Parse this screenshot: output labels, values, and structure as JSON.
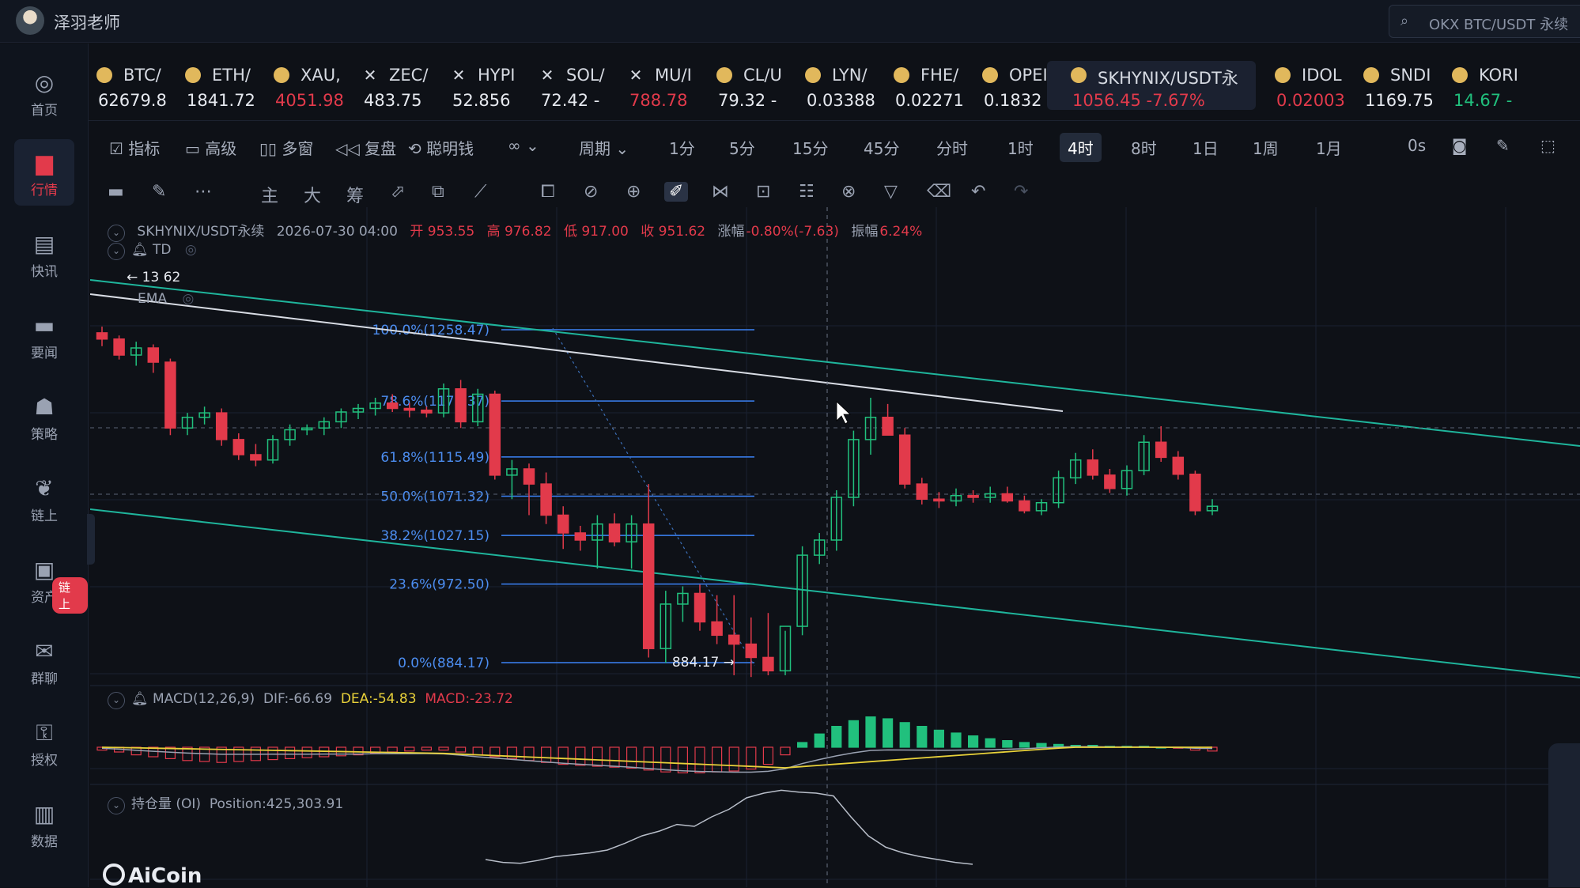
{
  "user": {
    "name": "泽羽老师"
  },
  "search": {
    "placeholder": "OKX BTC/USDT 永续"
  },
  "sidebar": {
    "items": [
      {
        "label": "首页",
        "icon": "home-icon"
      },
      {
        "label": "行情",
        "icon": "chart-bars-icon",
        "active": true
      },
      {
        "label": "快讯",
        "icon": "news-icon"
      },
      {
        "label": "要闻",
        "icon": "document-icon"
      },
      {
        "label": "策略",
        "icon": "robot-icon"
      },
      {
        "label": "链上",
        "icon": "chain-icon"
      },
      {
        "label": "资产",
        "icon": "wallet-icon"
      },
      {
        "label": "群聊",
        "icon": "chat-icon"
      },
      {
        "label": "授权",
        "icon": "key-icon"
      },
      {
        "label": "数据",
        "icon": "data-icon"
      }
    ],
    "badge": "链上"
  },
  "tickers": [
    {
      "symbol": "BTC/",
      "price": "62679.8",
      "dir": "up",
      "icon": "coin"
    },
    {
      "symbol": "ETH/",
      "price": "1841.72",
      "dir": "up",
      "icon": "coin"
    },
    {
      "symbol": "XAU,",
      "price": "4051.98",
      "dir": "down",
      "icon": "coin"
    },
    {
      "symbol": "ZEC/",
      "price": "483.75",
      "dir": "up",
      "icon": "x"
    },
    {
      "symbol": "HYPI",
      "price": "52.856",
      "dir": "up",
      "icon": "x"
    },
    {
      "symbol": "SOL/",
      "price": "72.42 -",
      "dir": "up",
      "icon": "x"
    },
    {
      "symbol": "MU/I",
      "price": "788.78",
      "dir": "down",
      "icon": "x"
    },
    {
      "symbol": "CL/U",
      "price": "79.32 -",
      "dir": "up",
      "icon": "coin"
    },
    {
      "symbol": "LYN/",
      "price": "0.03388",
      "dir": "up",
      "icon": "coin"
    },
    {
      "symbol": "FHE/",
      "price": "0.02271",
      "dir": "up",
      "icon": "coin"
    },
    {
      "symbol": "OPEI",
      "price": "0.1832",
      "dir": "up",
      "icon": "coin"
    },
    {
      "symbol": "SKHYNIX/USDT永",
      "price": "1056.45 -7.67%",
      "dir": "down",
      "icon": "coin",
      "active": true
    },
    {
      "symbol": "IDOL",
      "price": "0.02003",
      "dir": "down",
      "icon": "coin"
    },
    {
      "symbol": "SNDI",
      "price": "1169.75",
      "dir": "up",
      "icon": "coin"
    },
    {
      "symbol": "KORI",
      "price": "14.67 -",
      "dir": "green",
      "icon": "coin"
    }
  ],
  "toolbar": {
    "indicators": "指标",
    "advanced": "高级",
    "multi_window": "多窗",
    "replay": "复盘",
    "smart_money": "聪明钱",
    "period_label": "周期",
    "periods": [
      "1分",
      "5分",
      "15分",
      "45分",
      "分时",
      "1时",
      "4时",
      "8时",
      "1日",
      "1周",
      "1月"
    ],
    "active_period": "4时",
    "countdown": "0s"
  },
  "drawbar": {
    "main": "主",
    "big": "大",
    "chip": "筹"
  },
  "info": {
    "pair": "SKHYNIX/USDT永续",
    "datetime": "2026-07-30 04:00",
    "open": "开 953.55",
    "high": "高 976.82",
    "low": "低 917.00",
    "close": "收 951.62",
    "change_label": "涨幅",
    "change": "-0.80%(-7.63)",
    "amplitude_label": "振幅",
    "amplitude": "6.24%"
  },
  "indicators": {
    "td": "TD",
    "ema": "EMA",
    "marker_value": "62",
    "marker_prefix": "13",
    "macd": {
      "name": "MACD(12,26,9)",
      "dif": "DIF:-66.69",
      "dea": "DEA:-54.83",
      "macd": "MACD:-23.72"
    },
    "oi": {
      "name": "持仓量 (OI)",
      "position": "Position:425,303.91"
    }
  },
  "fib_levels": [
    {
      "label": "100.0%(1258.47)",
      "price": 1258.47
    },
    {
      "label": "78.6%(1178.37)",
      "price": 1178.37
    },
    {
      "label": "61.8%(1115.49)",
      "price": 1115.49
    },
    {
      "label": "50.0%(1071.32)",
      "price": 1071.32
    },
    {
      "label": "38.2%(1027.15)",
      "price": 1027.15
    },
    {
      "label": "23.6%(972.50)",
      "price": 972.5
    },
    {
      "label": "0.0%(884.17)",
      "price": 884.17
    }
  ],
  "low_marker": "884.17",
  "chart_data": {
    "type": "candlestick",
    "ohlc": [
      [
        1255,
        1262,
        1240,
        1248
      ],
      [
        1248,
        1252,
        1225,
        1230
      ],
      [
        1230,
        1245,
        1218,
        1238
      ],
      [
        1238,
        1242,
        1210,
        1222
      ],
      [
        1222,
        1226,
        1140,
        1148
      ],
      [
        1148,
        1165,
        1140,
        1160
      ],
      [
        1160,
        1172,
        1152,
        1165
      ],
      [
        1165,
        1170,
        1128,
        1135
      ],
      [
        1135,
        1142,
        1112,
        1118
      ],
      [
        1118,
        1130,
        1105,
        1112
      ],
      [
        1112,
        1140,
        1108,
        1135
      ],
      [
        1135,
        1152,
        1128,
        1146
      ],
      [
        1146,
        1152,
        1140,
        1148
      ],
      [
        1148,
        1160,
        1140,
        1155
      ],
      [
        1155,
        1170,
        1148,
        1166
      ],
      [
        1166,
        1175,
        1158,
        1170
      ],
      [
        1170,
        1182,
        1162,
        1176
      ],
      [
        1176,
        1186,
        1166,
        1170
      ],
      [
        1170,
        1176,
        1160,
        1168
      ],
      [
        1168,
        1172,
        1160,
        1165
      ],
      [
        1165,
        1198,
        1160,
        1192
      ],
      [
        1192,
        1202,
        1148,
        1155
      ],
      [
        1155,
        1192,
        1150,
        1186
      ],
      [
        1186,
        1190,
        1090,
        1095
      ],
      [
        1095,
        1112,
        1068,
        1102
      ],
      [
        1102,
        1108,
        1050,
        1085
      ],
      [
        1085,
        1098,
        1040,
        1050
      ],
      [
        1050,
        1060,
        1012,
        1030
      ],
      [
        1030,
        1038,
        1010,
        1022
      ],
      [
        1022,
        1050,
        990,
        1040
      ],
      [
        1040,
        1052,
        1015,
        1020
      ],
      [
        1020,
        1050,
        990,
        1040
      ],
      [
        1040,
        1085,
        890,
        900
      ],
      [
        900,
        965,
        884,
        950
      ],
      [
        950,
        970,
        930,
        962
      ],
      [
        962,
        972,
        920,
        930
      ],
      [
        930,
        960,
        905,
        915
      ],
      [
        915,
        960,
        870,
        905
      ],
      [
        905,
        935,
        868,
        890
      ],
      [
        890,
        940,
        870,
        875
      ],
      [
        875,
        920,
        870,
        925
      ],
      [
        925,
        1015,
        915,
        1005
      ],
      [
        1005,
        1030,
        995,
        1022
      ],
      [
        1022,
        1078,
        1010,
        1070
      ],
      [
        1070,
        1145,
        1060,
        1135
      ],
      [
        1135,
        1182,
        1118,
        1160
      ],
      [
        1160,
        1175,
        1140,
        1140
      ],
      [
        1140,
        1148,
        1080,
        1085
      ],
      [
        1085,
        1092,
        1062,
        1068
      ],
      [
        1068,
        1076,
        1058,
        1066
      ],
      [
        1066,
        1080,
        1060,
        1072
      ],
      [
        1072,
        1078,
        1064,
        1070
      ],
      [
        1070,
        1082,
        1064,
        1074
      ],
      [
        1074,
        1082,
        1064,
        1066
      ],
      [
        1066,
        1072,
        1052,
        1055
      ],
      [
        1055,
        1068,
        1050,
        1064
      ],
      [
        1064,
        1100,
        1058,
        1092
      ],
      [
        1092,
        1120,
        1085,
        1112
      ],
      [
        1112,
        1124,
        1090,
        1095
      ],
      [
        1095,
        1102,
        1075,
        1080
      ],
      [
        1080,
        1106,
        1072,
        1100
      ],
      [
        1100,
        1140,
        1095,
        1132
      ],
      [
        1132,
        1150,
        1110,
        1115
      ],
      [
        1115,
        1122,
        1090,
        1096
      ],
      [
        1096,
        1100,
        1050,
        1055
      ],
      [
        1055,
        1068,
        1050,
        1060
      ]
    ],
    "macd_hist": [
      -3,
      -5,
      -8,
      -10,
      -12,
      -14,
      -15,
      -16,
      -15,
      -14,
      -13,
      -12,
      -11,
      -10,
      -9,
      -8,
      -6,
      -5,
      -4,
      -3,
      -3,
      -5,
      -8,
      -10,
      -12,
      -14,
      -16,
      -18,
      -19,
      -20,
      -21,
      -22,
      -24,
      -26,
      -27,
      -27,
      -26,
      -25,
      -23,
      -18,
      -8,
      5,
      14,
      22,
      28,
      32,
      30,
      26,
      22,
      18,
      15,
      12,
      9,
      7,
      5,
      4,
      3,
      2,
      2,
      1,
      1,
      1,
      0,
      -1,
      -3,
      -4
    ],
    "oi": [
      0.25,
      0.22,
      0.21,
      0.24,
      0.28,
      0.3,
      0.32,
      0.35,
      0.42,
      0.5,
      0.55,
      0.62,
      0.6,
      0.7,
      0.78,
      0.9,
      0.95,
      0.98,
      0.96,
      0.95,
      0.92,
      0.7,
      0.5,
      0.38,
      0.32,
      0.28,
      0.25,
      0.22,
      0.2
    ]
  }
}
